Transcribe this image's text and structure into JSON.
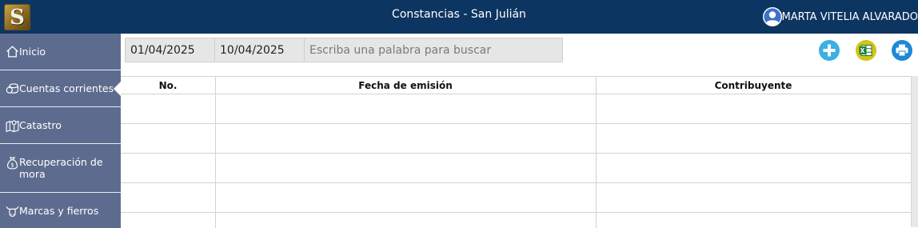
{
  "header": {
    "app_title": "Constancias - San Julián",
    "logo_letter": "S",
    "user_name": "MARTA VITELIA ALVARADO",
    "colors": {
      "bar": "#0d3561",
      "sidebar": "#5d6c8e"
    }
  },
  "sidebar": {
    "items": [
      {
        "label": "Inicio",
        "icon": "home-icon"
      },
      {
        "label": "Cuentas corrientes",
        "icon": "coins-icon",
        "active": true
      },
      {
        "label": "Catastro",
        "icon": "map-pin-icon"
      },
      {
        "label": "Recuperación de mora",
        "icon": "money-bag-icon"
      },
      {
        "label": "Marcas y fierros",
        "icon": "cattle-icon"
      }
    ]
  },
  "filters": {
    "date_from": "01/04/2025",
    "date_to": "10/04/2025",
    "search_placeholder": "Escriba una palabra para buscar",
    "search_value": ""
  },
  "actions": {
    "add_icon": "plus-circle-icon",
    "excel_icon": "excel-icon",
    "print_icon": "print-icon"
  },
  "table": {
    "columns": [
      "No.",
      "Fecha de emisión",
      "Contribuyente"
    ],
    "rows": [
      [
        "",
        "",
        ""
      ],
      [
        "",
        "",
        ""
      ],
      [
        "",
        "",
        ""
      ],
      [
        "",
        "",
        ""
      ]
    ]
  }
}
